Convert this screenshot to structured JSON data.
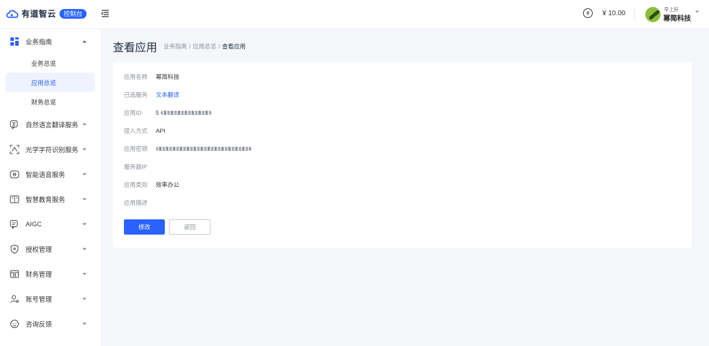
{
  "header": {
    "brand": "有道智云",
    "console_badge": "控制台",
    "balance": "¥ 10.00",
    "greeting": "早上好",
    "user_name": "幂简科技"
  },
  "sidebar": {
    "groups": [
      {
        "label": "业务指南",
        "icon": "grid-icon",
        "expanded": true,
        "children": [
          {
            "label": "业务总览",
            "active": false
          },
          {
            "label": "应用总览",
            "active": true
          },
          {
            "label": "财务总览",
            "active": false
          }
        ]
      },
      {
        "label": "自然语言翻译服务",
        "icon": "translate-icon"
      },
      {
        "label": "光学字符识别服务",
        "icon": "ocr-scan-icon"
      },
      {
        "label": "智能语音服务",
        "icon": "voice-icon"
      },
      {
        "label": "智慧教育服务",
        "icon": "education-icon"
      },
      {
        "label": "AIGC",
        "icon": "aigc-icon"
      },
      {
        "label": "授权管理",
        "icon": "shield-icon"
      },
      {
        "label": "财务管理",
        "icon": "finance-icon"
      },
      {
        "label": "账号管理",
        "icon": "account-icon"
      },
      {
        "label": "咨询反馈",
        "icon": "feedback-icon"
      }
    ]
  },
  "page": {
    "title": "查看应用",
    "breadcrumb": [
      "业务指南",
      "应用总览",
      "查看应用"
    ],
    "breadcrumb_sep": "/"
  },
  "details": {
    "app_name": {
      "label": "应用名称",
      "value": "幂简科技"
    },
    "services": {
      "label": "已选服务",
      "value": "文本翻译"
    },
    "app_id": {
      "label": "应用ID",
      "value": "5"
    },
    "access_method": {
      "label": "接入方式",
      "value": "API"
    },
    "app_secret": {
      "label": "应用密钥",
      "value": ""
    },
    "server_ip": {
      "label": "服务器IP",
      "value": ""
    },
    "category": {
      "label": "应用类别",
      "value": "效率办公"
    },
    "description": {
      "label": "应用描述",
      "value": ""
    }
  },
  "actions": {
    "edit_label": "修改",
    "back_label": "返回"
  },
  "colors": {
    "accent": "#2962ff",
    "background": "#f4f6fa"
  }
}
